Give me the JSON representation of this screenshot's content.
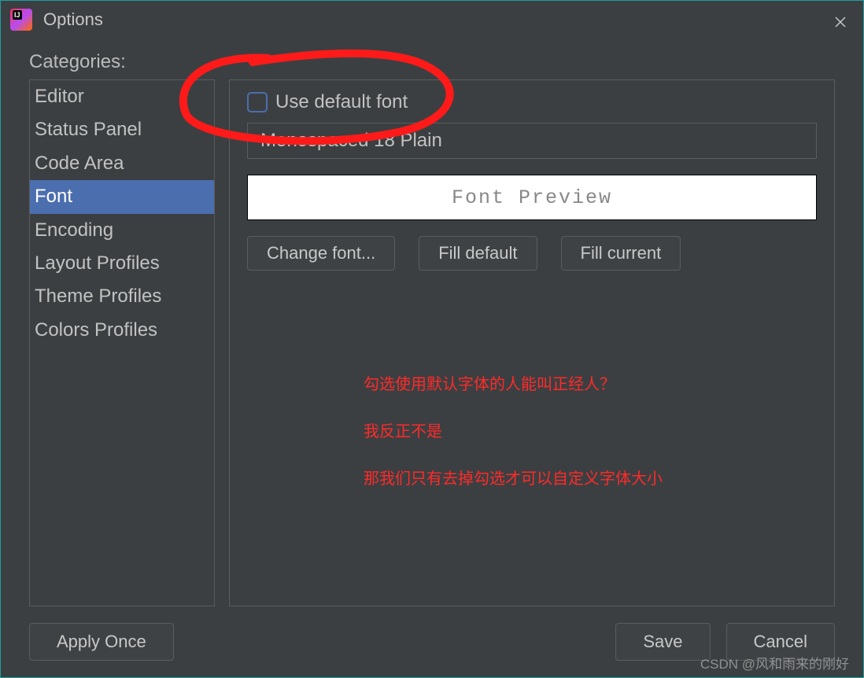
{
  "window": {
    "title": "Options"
  },
  "categories_label": "Categories:",
  "sidebar": {
    "items": [
      {
        "label": "Editor"
      },
      {
        "label": "Status Panel"
      },
      {
        "label": "Code Area"
      },
      {
        "label": "Font",
        "selected": true
      },
      {
        "label": "Encoding"
      },
      {
        "label": "Layout Profiles"
      },
      {
        "label": "Theme Profiles"
      },
      {
        "label": "Colors Profiles"
      }
    ]
  },
  "font_panel": {
    "use_default_label": "Use default font",
    "font_value": "Monospaced 18 Plain",
    "preview_label": "Font Preview",
    "buttons": {
      "change": "Change font...",
      "fill_default": "Fill default",
      "fill_current": "Fill current"
    }
  },
  "annotations": {
    "line1": "勾选使用默认字体的人能叫正经人？",
    "line2": "我反正不是",
    "line3": "那我们只有去掉勾选才可以自定义字体大小"
  },
  "footer": {
    "apply_once": "Apply Once",
    "save": "Save",
    "cancel": "Cancel"
  },
  "watermark": "CSDN @风和雨来的刚好"
}
